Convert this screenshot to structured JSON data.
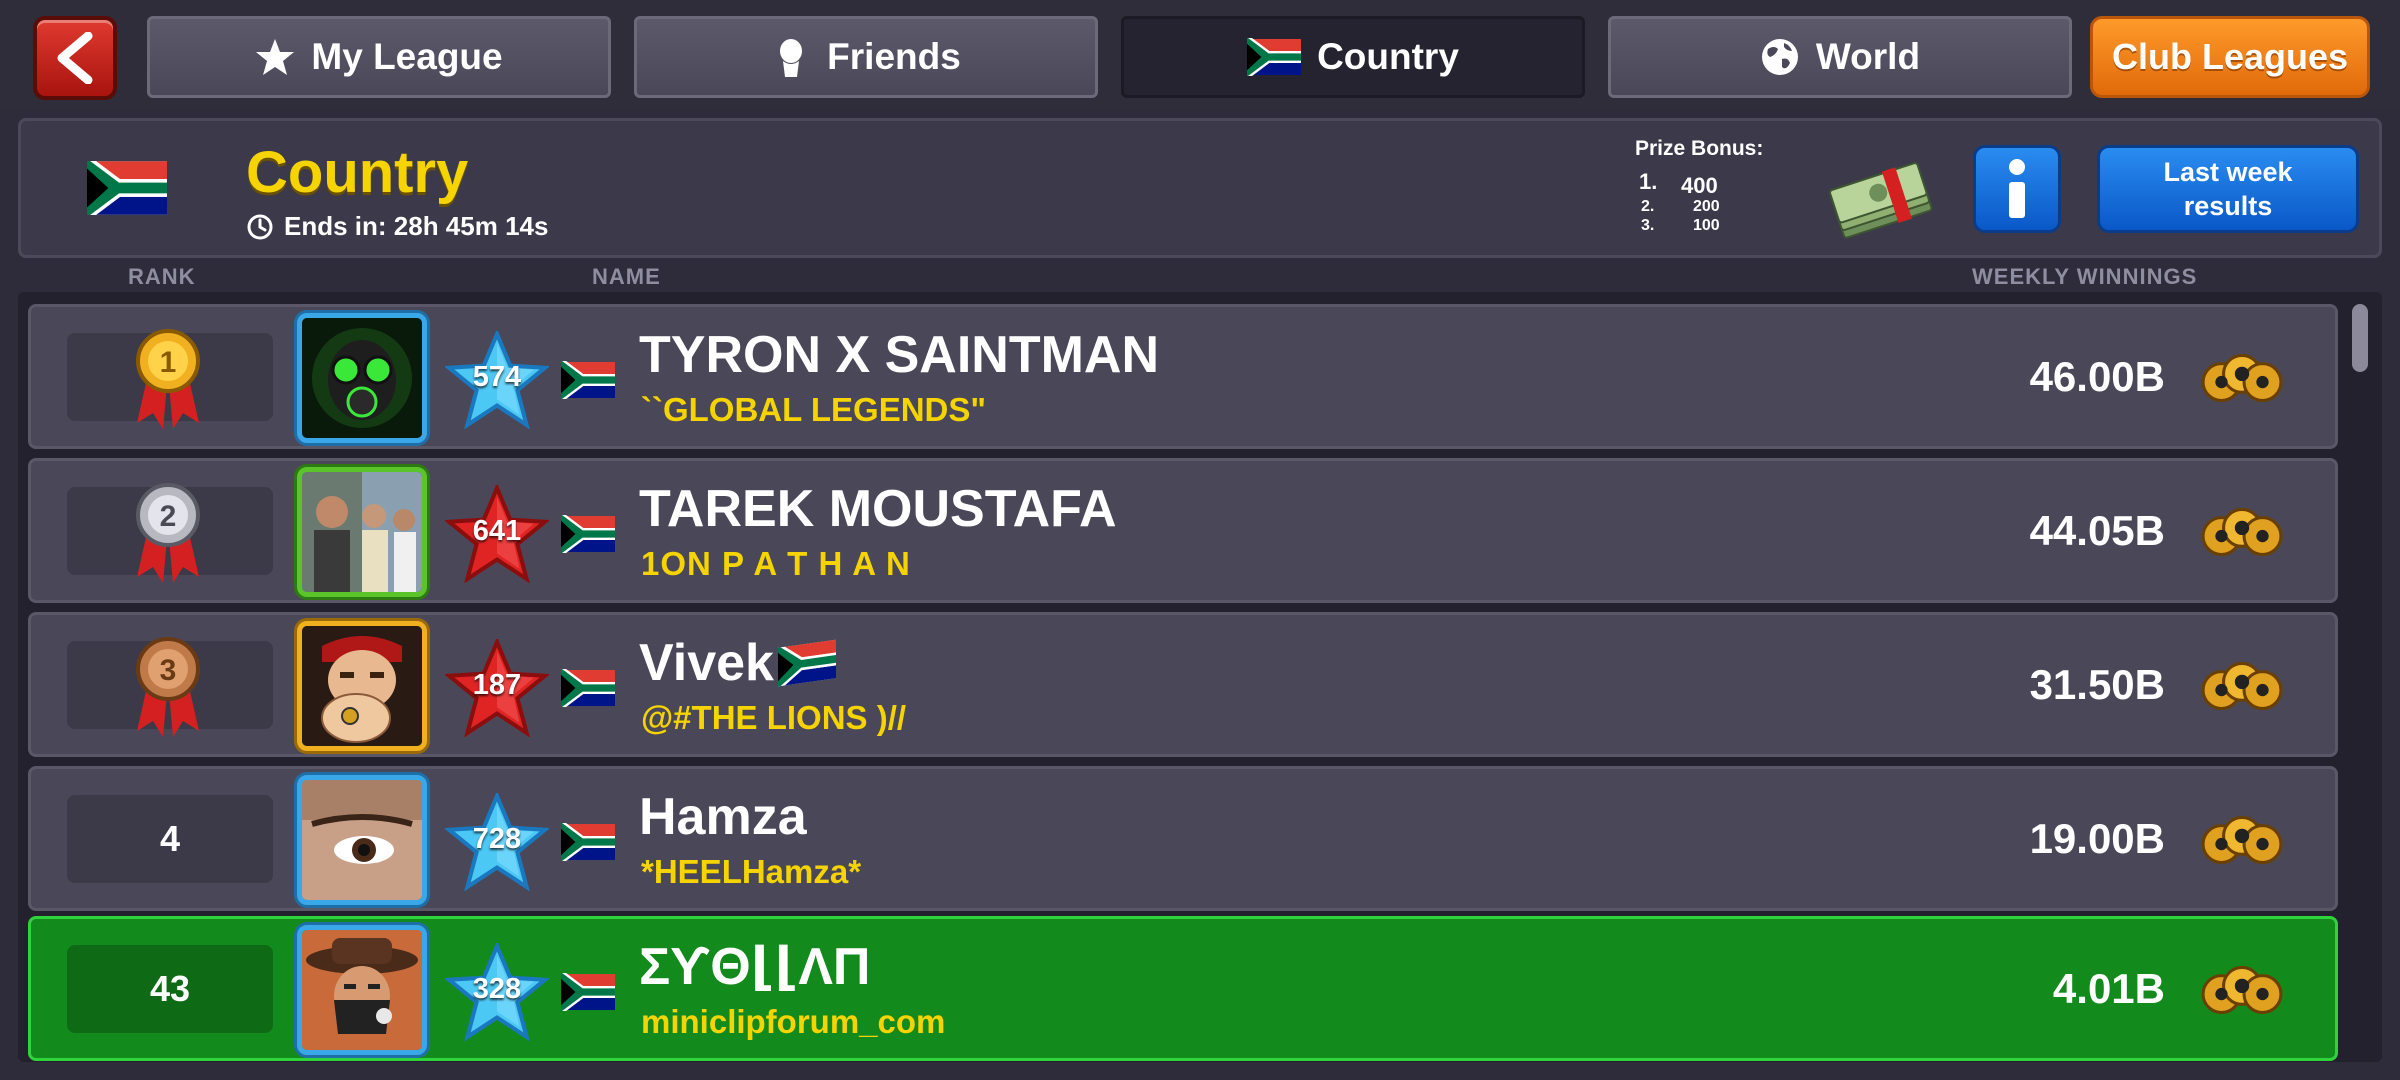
{
  "tabs": [
    {
      "label": "My League",
      "icon": "star-icon"
    },
    {
      "label": "Friends",
      "icon": "person-icon"
    },
    {
      "label": "Country",
      "icon": "south-africa-flag-icon",
      "active": true
    },
    {
      "label": "World",
      "icon": "globe-icon"
    }
  ],
  "club_leagues_label": "Club Leagues",
  "header": {
    "title": "Country",
    "ends_in": "Ends in: 28h 45m 14s",
    "prize_bonus_label": "Prize Bonus:",
    "prizes": [
      {
        "place": "1.",
        "amount": "400"
      },
      {
        "place": "2.",
        "amount": "200"
      },
      {
        "place": "3.",
        "amount": "100"
      }
    ],
    "last_week_label": "Last week results"
  },
  "columns": {
    "rank": "RANK",
    "name": "NAME",
    "winnings": "WEEKLY WINNINGS"
  },
  "rows": [
    {
      "rank": "1",
      "medal": "gold",
      "level": "574",
      "level_color": "blue",
      "name": "TYRON X SAINTMAN",
      "club": "``GLOBAL LEGENDS\"",
      "winnings": "46.00B"
    },
    {
      "rank": "2",
      "medal": "silver",
      "level": "641",
      "level_color": "red",
      "name": "TAREK MOUSTAFA",
      "club": "1ON P A T H A N",
      "winnings": "44.05B"
    },
    {
      "rank": "3",
      "medal": "bronze",
      "level": "187",
      "level_color": "red",
      "name": "Vivek",
      "club": "@#THE LIONS )//",
      "winnings": "31.50B"
    },
    {
      "rank": "4",
      "medal": "",
      "level": "728",
      "level_color": "blue",
      "name": "Hamza",
      "club": "*HEELHamza*",
      "winnings": "19.00B"
    },
    {
      "rank": "43",
      "medal": "",
      "level": "328",
      "level_color": "blue",
      "name": "ΣϒΘ⌊⌊ΛΠ",
      "club": "miniclipforum_com",
      "winnings": "4.01B",
      "is_current_user": true
    }
  ],
  "colors": {
    "accent_yellow": "#f5d400",
    "current_user_row": "#138a1c",
    "club_button": "#f58a1a",
    "info_blue": "#1a72dc"
  }
}
